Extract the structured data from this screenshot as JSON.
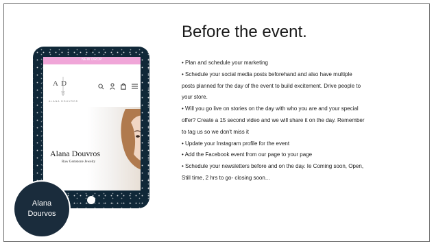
{
  "slide": {
    "heading": "Before the event.",
    "bullet_lines": [
      "• Plan and schedule your marketing",
      "• Schedule your social media posts beforehand and also have multiple",
      "posts planned for the day of the event to build excitement. Drive people to",
      "your store.",
      "• Will you go live on stories on the day with who you are and your special",
      "offer? Create a 15 second video and we will share it on the day. Remember",
      "to tag us so we don't miss it",
      "• Update your Instagram profile for the event",
      "• Add the Facebook event from our page to your page",
      "• Schedule your newsletters before and on the day. Ie Coming soon, Open,",
      "Still time, 2 hrs to go- closing soon..."
    ],
    "badge": {
      "line1": "Alana",
      "line2": "Dourvos"
    }
  },
  "tablet_screen": {
    "promo_text": "NEW DROP",
    "logo_initials": "A D",
    "logo_subtitle": "ALANA DOUVROS",
    "hero_title": "Alana Douvros",
    "hero_subtitle": "Raw Gemstone Jewelry"
  },
  "colors": {
    "tablet_frame": "#102838",
    "promo_bar": "#f0a6d8",
    "badge": "#1a2c3c"
  }
}
